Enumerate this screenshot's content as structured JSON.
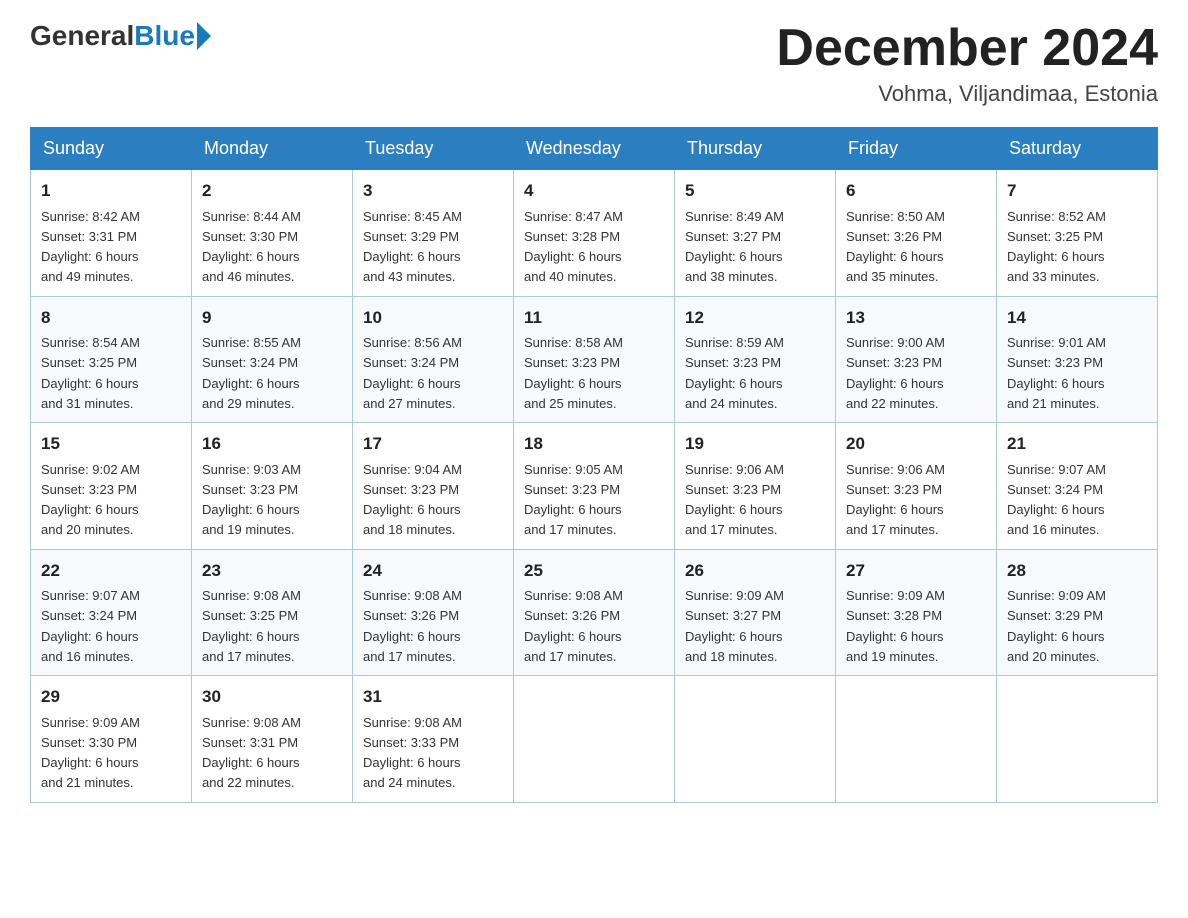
{
  "header": {
    "logo_general": "General",
    "logo_blue": "Blue",
    "month_title": "December 2024",
    "location": "Vohma, Viljandimaa, Estonia"
  },
  "days_of_week": [
    "Sunday",
    "Monday",
    "Tuesday",
    "Wednesday",
    "Thursday",
    "Friday",
    "Saturday"
  ],
  "weeks": [
    [
      {
        "day": "1",
        "sunrise": "8:42 AM",
        "sunset": "3:31 PM",
        "daylight": "6 hours and 49 minutes."
      },
      {
        "day": "2",
        "sunrise": "8:44 AM",
        "sunset": "3:30 PM",
        "daylight": "6 hours and 46 minutes."
      },
      {
        "day": "3",
        "sunrise": "8:45 AM",
        "sunset": "3:29 PM",
        "daylight": "6 hours and 43 minutes."
      },
      {
        "day": "4",
        "sunrise": "8:47 AM",
        "sunset": "3:28 PM",
        "daylight": "6 hours and 40 minutes."
      },
      {
        "day": "5",
        "sunrise": "8:49 AM",
        "sunset": "3:27 PM",
        "daylight": "6 hours and 38 minutes."
      },
      {
        "day": "6",
        "sunrise": "8:50 AM",
        "sunset": "3:26 PM",
        "daylight": "6 hours and 35 minutes."
      },
      {
        "day": "7",
        "sunrise": "8:52 AM",
        "sunset": "3:25 PM",
        "daylight": "6 hours and 33 minutes."
      }
    ],
    [
      {
        "day": "8",
        "sunrise": "8:54 AM",
        "sunset": "3:25 PM",
        "daylight": "6 hours and 31 minutes."
      },
      {
        "day": "9",
        "sunrise": "8:55 AM",
        "sunset": "3:24 PM",
        "daylight": "6 hours and 29 minutes."
      },
      {
        "day": "10",
        "sunrise": "8:56 AM",
        "sunset": "3:24 PM",
        "daylight": "6 hours and 27 minutes."
      },
      {
        "day": "11",
        "sunrise": "8:58 AM",
        "sunset": "3:23 PM",
        "daylight": "6 hours and 25 minutes."
      },
      {
        "day": "12",
        "sunrise": "8:59 AM",
        "sunset": "3:23 PM",
        "daylight": "6 hours and 24 minutes."
      },
      {
        "day": "13",
        "sunrise": "9:00 AM",
        "sunset": "3:23 PM",
        "daylight": "6 hours and 22 minutes."
      },
      {
        "day": "14",
        "sunrise": "9:01 AM",
        "sunset": "3:23 PM",
        "daylight": "6 hours and 21 minutes."
      }
    ],
    [
      {
        "day": "15",
        "sunrise": "9:02 AM",
        "sunset": "3:23 PM",
        "daylight": "6 hours and 20 minutes."
      },
      {
        "day": "16",
        "sunrise": "9:03 AM",
        "sunset": "3:23 PM",
        "daylight": "6 hours and 19 minutes."
      },
      {
        "day": "17",
        "sunrise": "9:04 AM",
        "sunset": "3:23 PM",
        "daylight": "6 hours and 18 minutes."
      },
      {
        "day": "18",
        "sunrise": "9:05 AM",
        "sunset": "3:23 PM",
        "daylight": "6 hours and 17 minutes."
      },
      {
        "day": "19",
        "sunrise": "9:06 AM",
        "sunset": "3:23 PM",
        "daylight": "6 hours and 17 minutes."
      },
      {
        "day": "20",
        "sunrise": "9:06 AM",
        "sunset": "3:23 PM",
        "daylight": "6 hours and 17 minutes."
      },
      {
        "day": "21",
        "sunrise": "9:07 AM",
        "sunset": "3:24 PM",
        "daylight": "6 hours and 16 minutes."
      }
    ],
    [
      {
        "day": "22",
        "sunrise": "9:07 AM",
        "sunset": "3:24 PM",
        "daylight": "6 hours and 16 minutes."
      },
      {
        "day": "23",
        "sunrise": "9:08 AM",
        "sunset": "3:25 PM",
        "daylight": "6 hours and 17 minutes."
      },
      {
        "day": "24",
        "sunrise": "9:08 AM",
        "sunset": "3:26 PM",
        "daylight": "6 hours and 17 minutes."
      },
      {
        "day": "25",
        "sunrise": "9:08 AM",
        "sunset": "3:26 PM",
        "daylight": "6 hours and 17 minutes."
      },
      {
        "day": "26",
        "sunrise": "9:09 AM",
        "sunset": "3:27 PM",
        "daylight": "6 hours and 18 minutes."
      },
      {
        "day": "27",
        "sunrise": "9:09 AM",
        "sunset": "3:28 PM",
        "daylight": "6 hours and 19 minutes."
      },
      {
        "day": "28",
        "sunrise": "9:09 AM",
        "sunset": "3:29 PM",
        "daylight": "6 hours and 20 minutes."
      }
    ],
    [
      {
        "day": "29",
        "sunrise": "9:09 AM",
        "sunset": "3:30 PM",
        "daylight": "6 hours and 21 minutes."
      },
      {
        "day": "30",
        "sunrise": "9:08 AM",
        "sunset": "3:31 PM",
        "daylight": "6 hours and 22 minutes."
      },
      {
        "day": "31",
        "sunrise": "9:08 AM",
        "sunset": "3:33 PM",
        "daylight": "6 hours and 24 minutes."
      },
      null,
      null,
      null,
      null
    ]
  ],
  "labels": {
    "sunrise": "Sunrise:",
    "sunset": "Sunset:",
    "daylight": "Daylight:"
  }
}
